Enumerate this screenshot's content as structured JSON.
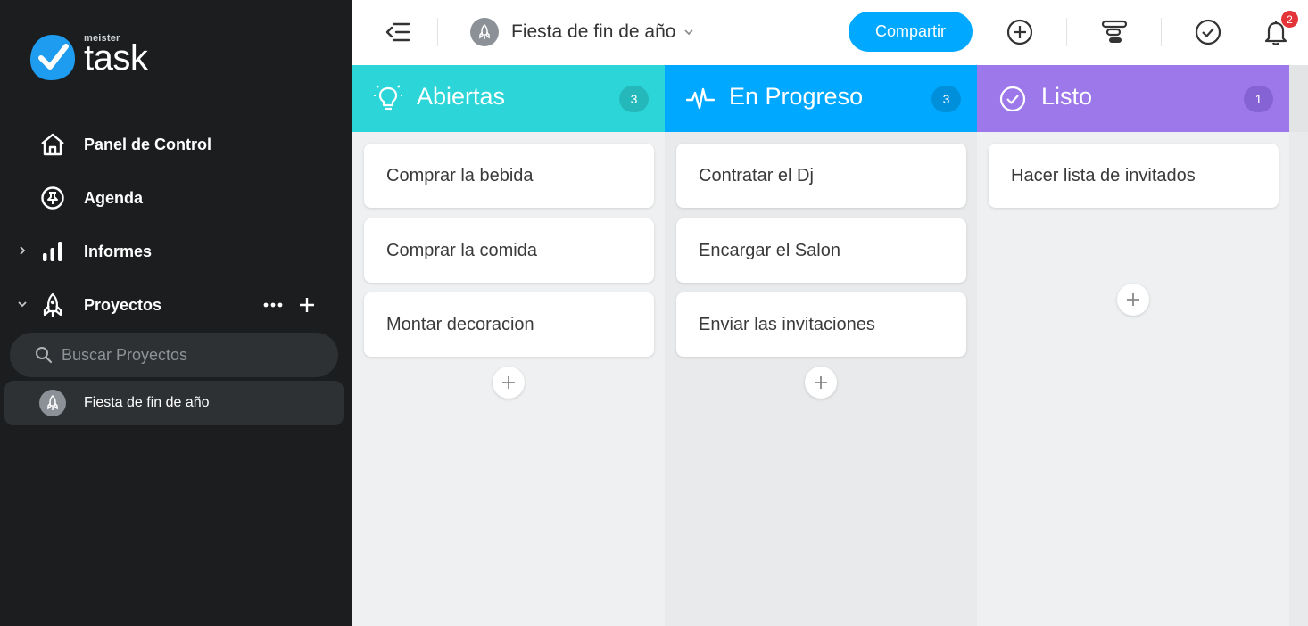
{
  "brand": {
    "small": "meister",
    "big": "task"
  },
  "nav": {
    "dashboard": "Panel de Control",
    "agenda": "Agenda",
    "reports": "Informes",
    "projects": "Proyectos"
  },
  "search": {
    "placeholder": "Buscar Proyectos"
  },
  "sidebar_project": {
    "name": "Fiesta de fin de año"
  },
  "topbar": {
    "project_title": "Fiesta de fin de año",
    "share_label": "Compartir",
    "notification_count": "2"
  },
  "columns": [
    {
      "title": "Abiertas",
      "count": "3",
      "color": "#2cd6d8",
      "cards": [
        "Comprar la bebida",
        "Comprar la comida",
        "Montar decoracion"
      ]
    },
    {
      "title": "En Progreso",
      "count": "3",
      "color": "#00a8ff",
      "cards": [
        "Contratar el Dj",
        "Encargar el Salon",
        "Enviar las invitaciones"
      ]
    },
    {
      "title": "Listo",
      "count": "1",
      "color": "#9c78ea",
      "cards": [
        "Hacer lista de invitados"
      ]
    }
  ],
  "icons": {
    "dashboard": "home-icon",
    "agenda": "pin-icon",
    "reports": "bar-chart-icon",
    "projects": "rocket-icon",
    "col1": "lightbulb-icon",
    "col2": "pulse-icon",
    "col3": "check-circle-icon"
  }
}
